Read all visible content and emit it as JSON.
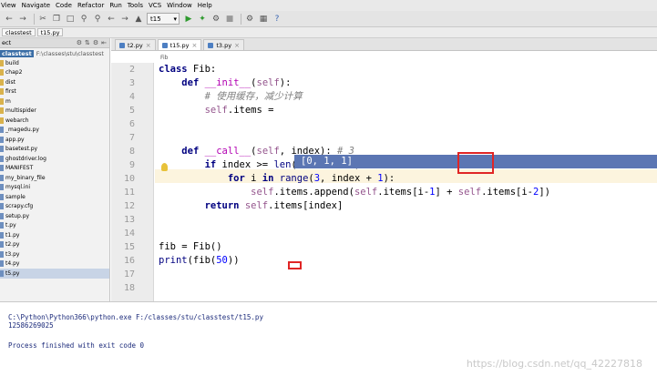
{
  "menubar": [
    "View",
    "Navigate",
    "Code",
    "Refactor",
    "Run",
    "Tools",
    "VCS",
    "Window",
    "Help"
  ],
  "toolbar": {
    "run_config": "t15"
  },
  "breadcrumb": [
    "classtest",
    "t15.py"
  ],
  "project_panel": {
    "label": "ect",
    "root_name": "classtest",
    "root_path": "F:\\classes\\stu\\classtest",
    "items": [
      {
        "name": "build",
        "kind": "folder"
      },
      {
        "name": "chap2",
        "kind": "folder"
      },
      {
        "name": "dist",
        "kind": "folder"
      },
      {
        "name": "first",
        "kind": "folder"
      },
      {
        "name": "m",
        "kind": "folder"
      },
      {
        "name": "multispider",
        "kind": "folder"
      },
      {
        "name": "webarch",
        "kind": "folder"
      },
      {
        "name": "_magedu.py",
        "kind": "file"
      },
      {
        "name": "app.py",
        "kind": "file"
      },
      {
        "name": "basetest.py",
        "kind": "file"
      },
      {
        "name": "ghostdriver.log",
        "kind": "file"
      },
      {
        "name": "MANIFEST",
        "kind": "file"
      },
      {
        "name": "my_binary_file",
        "kind": "file"
      },
      {
        "name": "mysql.ini",
        "kind": "file"
      },
      {
        "name": "sample",
        "kind": "file"
      },
      {
        "name": "scrapy.cfg",
        "kind": "file"
      },
      {
        "name": "setup.py",
        "kind": "file"
      },
      {
        "name": "t.py",
        "kind": "file"
      },
      {
        "name": "t1.py",
        "kind": "file"
      },
      {
        "name": "t2.py",
        "kind": "file"
      },
      {
        "name": "t3.py",
        "kind": "file"
      },
      {
        "name": "t4.py",
        "kind": "file"
      },
      {
        "name": "t5.py",
        "kind": "file"
      }
    ]
  },
  "editor_tabs": [
    "t2.py",
    "t15.py",
    "t3.py"
  ],
  "editor_breadcrumb": "Fib",
  "line_numbers": [
    "2",
    "3",
    "4",
    "5",
    "6",
    "7",
    "8",
    "9",
    "10",
    "11",
    "12",
    "13",
    "14",
    "15",
    "16",
    "17",
    "18"
  ],
  "code": {
    "l2_kw": "class",
    "l2_rest": " Fib:",
    "l3_indent": "    ",
    "l3_kw": "def",
    "l3_sp": " ",
    "l3_fn": "__init__",
    "l3_p1": "(",
    "l3_self": "self",
    "l3_p2": "):",
    "l4_indent": "        ",
    "l4_comment": "# 使用缓存，减少计算",
    "l5_indent": "        ",
    "l5_self": "self",
    "l5_rest": ".items =",
    "l7_indent": "    ",
    "l7_kw": "def",
    "l7_sp": " ",
    "l7_fn": "__call__",
    "l7_p1": "(",
    "l7_self": "self",
    "l7_p2": ", index): ",
    "l7_comment": "# 3",
    "l8_indent": "        ",
    "l8_kw": "if",
    "l8_a": " index >= ",
    "l8_len": "len",
    "l8_b": "(",
    "l8_self": "self",
    "l8_c": ".items):",
    "l9_indent": "            ",
    "l9_kw": "for",
    "l9_a": " i ",
    "l9_kw2": "in",
    "l9_b": " ",
    "l9_range": "range",
    "l9_c": "(",
    "l9_n3": "3",
    "l9_d": ", index + ",
    "l9_n1": "1",
    "l9_e": "):",
    "l10_indent": "                ",
    "l10_self1": "self",
    "l10_a": ".items.append(",
    "l10_self2": "self",
    "l10_b": ".items[i-",
    "l10_n1": "1",
    "l10_c": "] + ",
    "l10_self3": "self",
    "l10_d": ".items[i-",
    "l10_n2": "2",
    "l10_e": "])",
    "l11_indent": "        ",
    "l11_kw": "return",
    "l11_a": " ",
    "l11_self": "self",
    "l11_b": ".items[index]",
    "l15_text": "fib = Fib()",
    "l16_print": "print",
    "l16_a": "(fib(",
    "l16_num": "50",
    "l16_b": "))"
  },
  "selection_text": "[0, 1, 1]",
  "run_output": {
    "command": "C:\\Python\\Python366\\python.exe F:/classes/stu/classtest/t15.py",
    "result": "12586269025",
    "finished": "Process finished with exit code 0"
  },
  "watermark": "https://blog.csdn.net/qq_42227818"
}
